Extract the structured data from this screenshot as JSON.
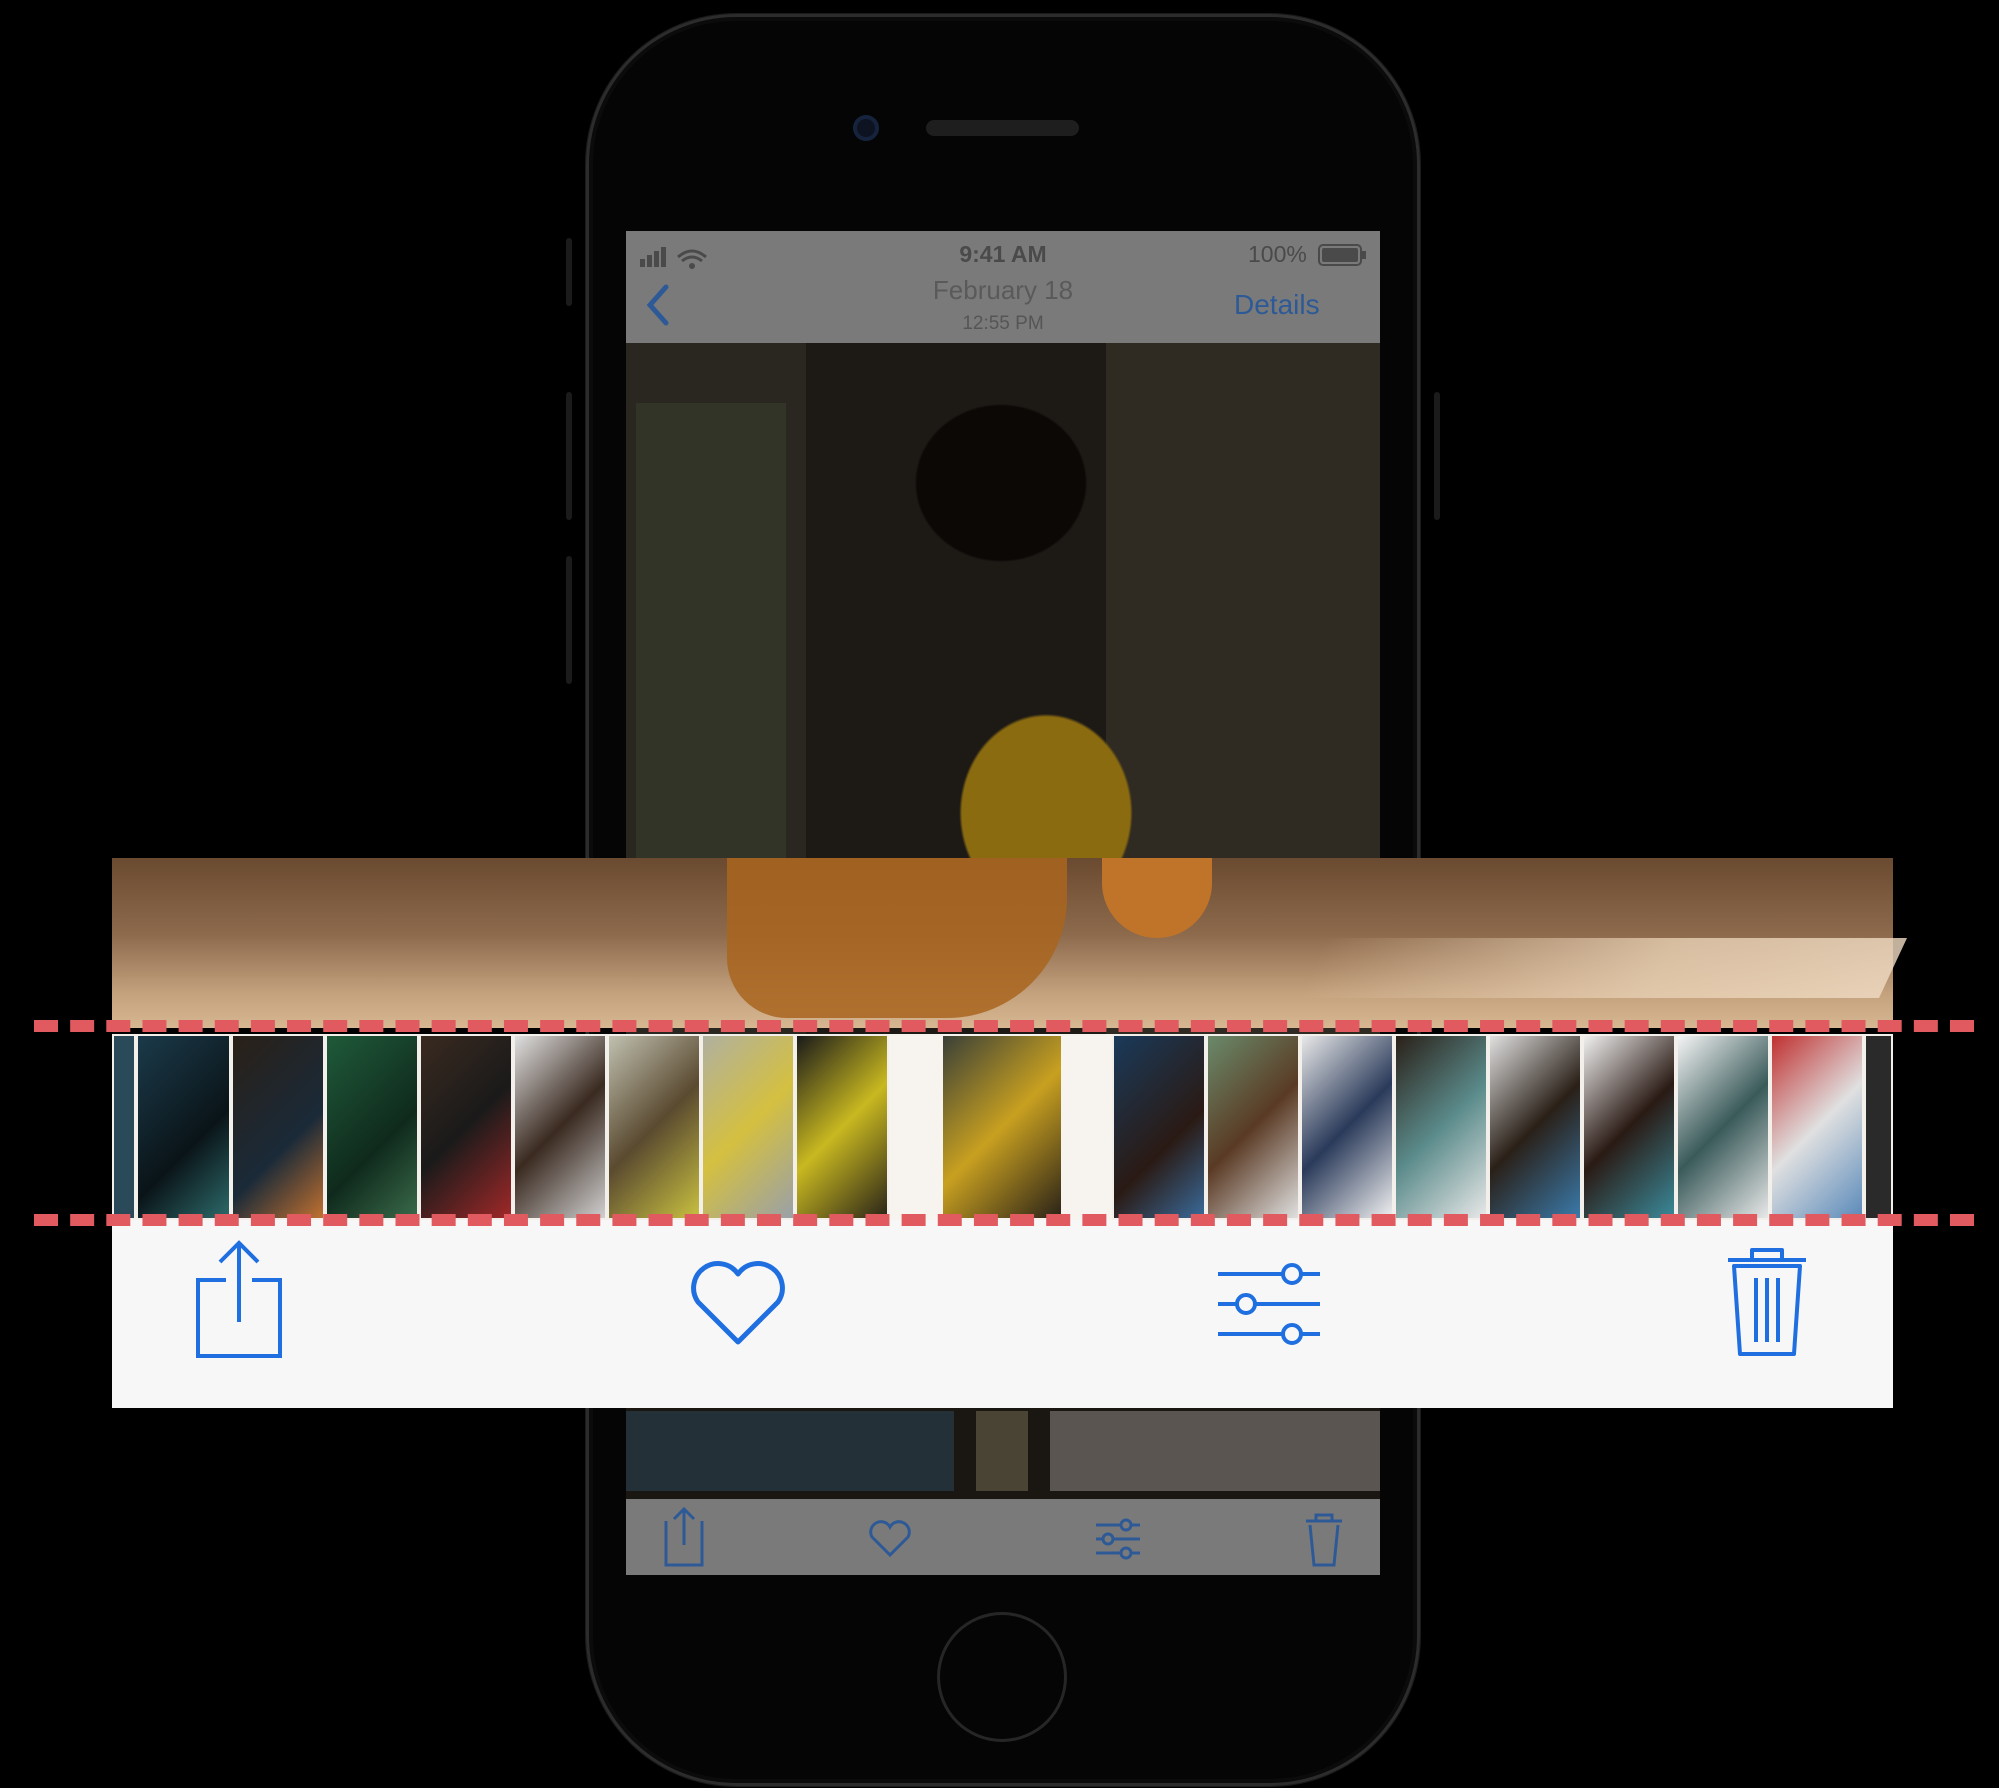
{
  "status_bar": {
    "time": "9:41 AM",
    "battery": "100%"
  },
  "nav": {
    "back_icon": "chevron-left-icon",
    "title": "February 18",
    "subtitle": "12:55 PM",
    "details": "Details"
  },
  "toolbar": {
    "icons": [
      "share-icon",
      "heart-icon",
      "adjust-icon",
      "trash-icon"
    ]
  },
  "colors": {
    "accent": "#1f6fe0",
    "highlight": "#e05a60",
    "toolbar_bg": "#f7f7f7"
  }
}
